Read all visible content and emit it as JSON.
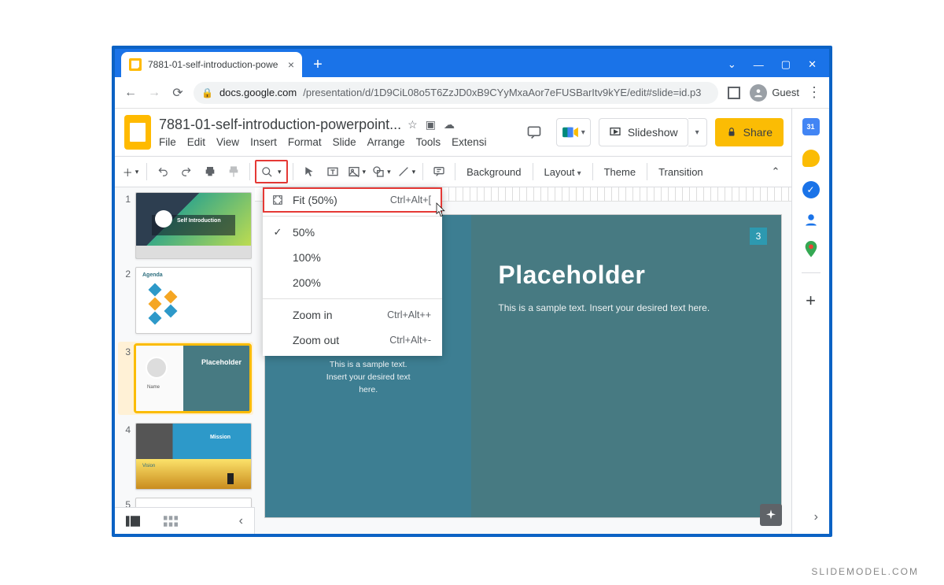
{
  "browser": {
    "tab_title": "7881-01-self-introduction-powe",
    "url_host": "docs.google.com",
    "url_path": "/presentation/d/1D9CiL08o5T6ZzJD0xB9CYyMxaAor7eFUSBarItv9kYE/edit#slide=id.p3",
    "profile_label": "Guest"
  },
  "slides_app": {
    "doc_title": "7881-01-self-introduction-powerpoint...",
    "menu": [
      "File",
      "Edit",
      "View",
      "Insert",
      "Format",
      "Slide",
      "Arrange",
      "Tools",
      "Extensi"
    ],
    "slideshow_label": "Slideshow",
    "share_label": "Share",
    "toolbar": {
      "background": "Background",
      "layout": "Layout",
      "theme": "Theme",
      "transition": "Transition"
    },
    "zoom_menu": {
      "fit_label": "Fit (50%)",
      "fit_shortcut": "Ctrl+Alt+[",
      "levels": [
        "50%",
        "100%",
        "200%"
      ],
      "selected": "50%",
      "zoom_in_label": "Zoom in",
      "zoom_in_shortcut": "Ctrl+Alt++",
      "zoom_out_label": "Zoom out",
      "zoom_out_shortcut": "Ctrl+Alt+-"
    },
    "thumbs": [
      {
        "num": "1",
        "title": "Self Introduction"
      },
      {
        "num": "2",
        "title": "Agenda"
      },
      {
        "num": "3",
        "title": "Placeholder"
      },
      {
        "num": "4",
        "mission": "Mission",
        "vision": "Vision"
      },
      {
        "num": "5"
      }
    ],
    "canvas": {
      "slide_number_badge": "3",
      "title": "Placeholder",
      "subtitle": "This is a sample text. Insert your desired text here.",
      "name_label": "Name",
      "left_sub_1": "This is a sample text.",
      "left_sub_2": "Insert your desired text",
      "left_sub_3": "here."
    }
  },
  "watermark": "SLIDEMODEL.COM"
}
